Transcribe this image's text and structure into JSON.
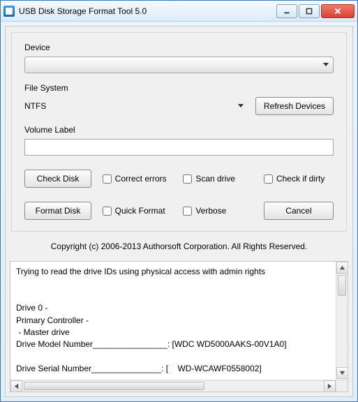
{
  "window": {
    "title": "USB Disk Storage Format Tool 5.0"
  },
  "labels": {
    "device": "Device",
    "file_system": "File System",
    "volume_label": "Volume Label"
  },
  "device": {
    "selected": ""
  },
  "file_system": {
    "selected": "NTFS"
  },
  "volume": {
    "value": ""
  },
  "buttons": {
    "refresh": "Refresh Devices",
    "check_disk": "Check Disk",
    "format_disk": "Format Disk",
    "cancel": "Cancel"
  },
  "checks": {
    "correct_errors": "Correct errors",
    "scan_drive": "Scan drive",
    "check_if_dirty": "Check if dirty",
    "quick_format": "Quick Format",
    "verbose": "Verbose"
  },
  "copyright": "Copyright (c) 2006-2013 Authorsoft Corporation. All Rights Reserved.",
  "log": "Trying to read the drive IDs using physical access with admin rights\n\n\nDrive 0 - \nPrimary Controller - \n - Master drive\nDrive Model Number________________: [WDC WD5000AAKS-00V1A0]\n\nDrive Serial Number_______________: [    WD-WCAWF0558002]"
}
